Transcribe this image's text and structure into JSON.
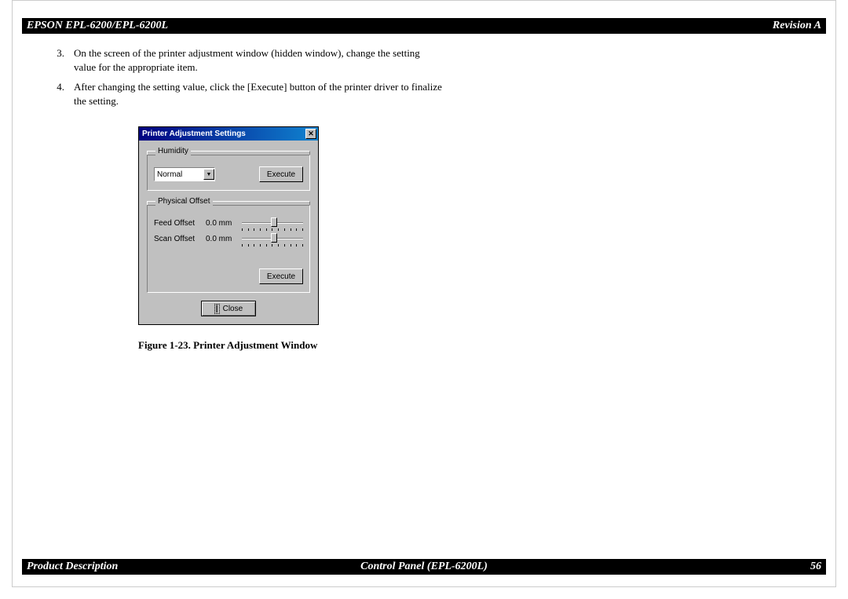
{
  "header": {
    "left": "EPSON EPL-6200/EPL-6200L",
    "right": "Revision A"
  },
  "footer": {
    "left": "Product Description",
    "center": "Control Panel (EPL-6200L)",
    "right": "56"
  },
  "steps": [
    {
      "num": "3.",
      "text": "On the screen of the printer adjustment window (hidden window), change the setting value for the appropriate item."
    },
    {
      "num": "4.",
      "text": "After changing the setting value, click the [Execute] button of the printer driver to finalize the setting."
    }
  ],
  "dialog": {
    "title": "Printer Adjustment Settings",
    "humidity_legend": "Humidity",
    "humidity_value": "Normal",
    "execute_label": "Execute",
    "physical_legend": "Physical Offset",
    "feed_label": "Feed Offset",
    "feed_value": "0.0 mm",
    "scan_label": "Scan Offset",
    "scan_value": "0.0 mm",
    "close_label": "Close"
  },
  "figcaption": "Figure 1-23.  Printer Adjustment Window"
}
